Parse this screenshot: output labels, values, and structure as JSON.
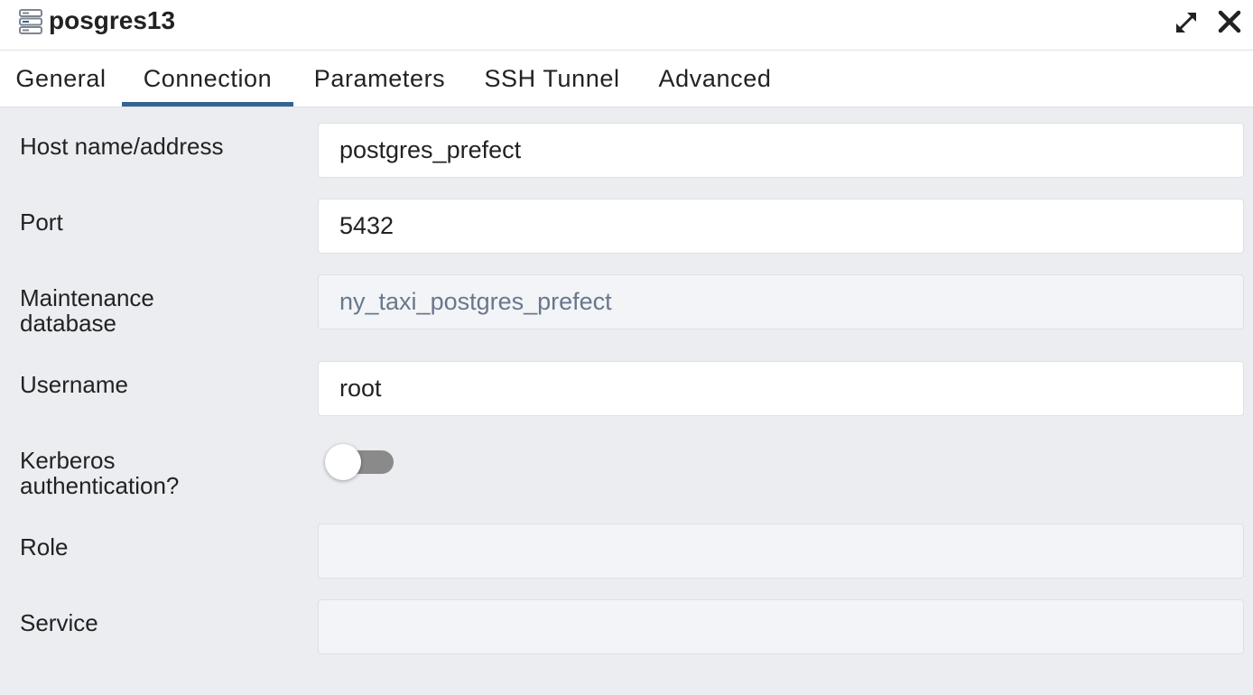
{
  "dialog": {
    "title": "posgres13",
    "icon": "server-icon",
    "controls": {
      "maximize_icon": "expand-icon",
      "close_icon": "close-icon"
    }
  },
  "tabs": [
    {
      "label": "General",
      "active": false
    },
    {
      "label": "Connection",
      "active": true
    },
    {
      "label": "Parameters",
      "active": false
    },
    {
      "label": "SSH Tunnel",
      "active": false
    },
    {
      "label": "Advanced",
      "active": false
    }
  ],
  "form": {
    "host": {
      "label": "Host name/address",
      "value": "postgres_prefect"
    },
    "port": {
      "label": "Port",
      "value": "5432"
    },
    "maintenance_db": {
      "label_line1": "Maintenance",
      "label_line2": "database",
      "value": "ny_taxi_postgres_prefect",
      "disabled": true
    },
    "username": {
      "label": "Username",
      "value": "root"
    },
    "kerberos": {
      "label_line1": "Kerberos",
      "label_line2": "authentication?",
      "enabled": false
    },
    "role": {
      "label": "Role",
      "value": "",
      "disabled": true
    },
    "service": {
      "label": "Service",
      "value": "",
      "disabled": true
    }
  },
  "colors": {
    "accent": "#326690",
    "panel_background": "#ebedf0",
    "toggle_off": "#8a8a8a",
    "disabled_text": "#69778a"
  }
}
